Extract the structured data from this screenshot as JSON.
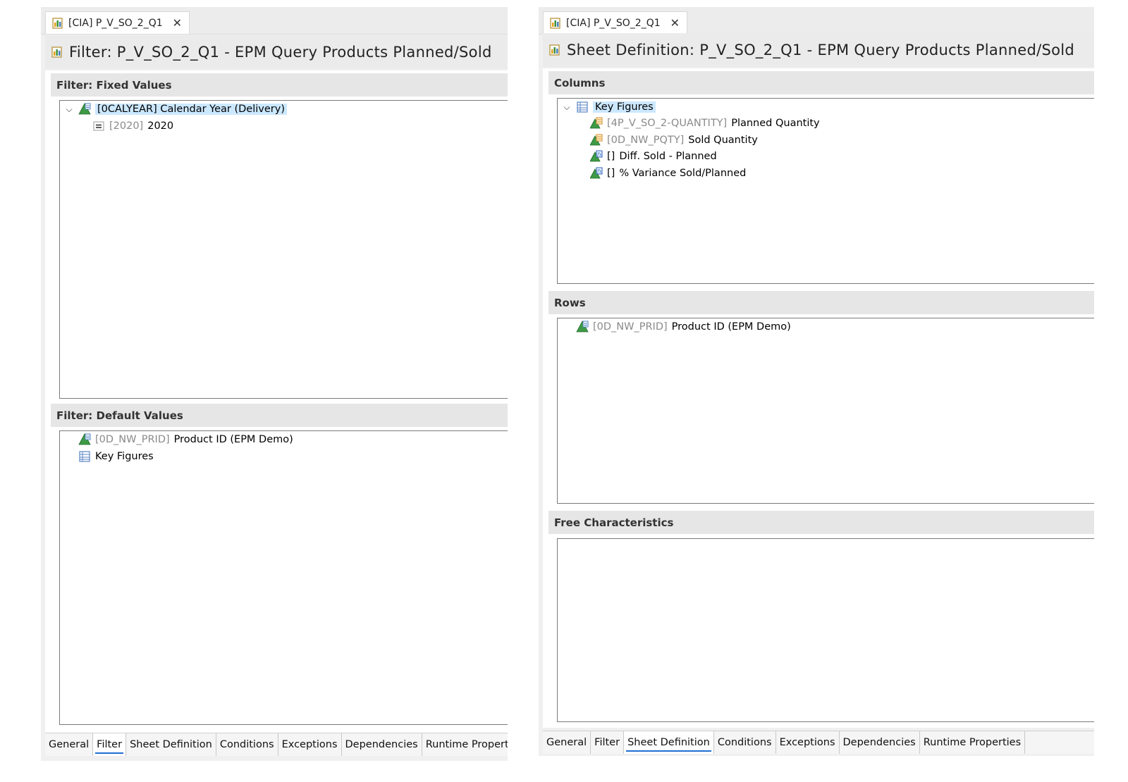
{
  "left": {
    "tab_label": "[CIA] P_V_SO_2_Q1",
    "title": "Filter: P_V_SO_2_Q1 - EPM Query Products Planned/Sold",
    "sections": [
      {
        "header": "Filter: Fixed Values",
        "items": [
          {
            "tech": "[0CALYEAR]",
            "label": "Calendar Year (Delivery)",
            "icon": "characteristic-icon",
            "expanded": true,
            "selected": true
          },
          {
            "tech": "[2020]",
            "label": "2020",
            "icon": "equals-icon"
          }
        ]
      },
      {
        "header": "Filter: Default Values",
        "items": [
          {
            "tech": "[0D_NW_PRID]",
            "label": "Product ID (EPM Demo)",
            "icon": "characteristic-icon"
          },
          {
            "tech": "",
            "label": "Key Figures",
            "icon": "key-figures-structure-icon"
          }
        ]
      }
    ],
    "bottom_tabs": [
      "General",
      "Filter",
      "Sheet Definition",
      "Conditions",
      "Exceptions",
      "Dependencies",
      "Runtime Properties"
    ],
    "active_tab": "Filter"
  },
  "right": {
    "tab_label": "[CIA] P_V_SO_2_Q1",
    "title": "Sheet Definition: P_V_SO_2_Q1 - EPM Query Products Planned/Sold",
    "sections": [
      {
        "header": "Columns",
        "items": [
          {
            "tech": "",
            "label": "Key Figures",
            "icon": "key-figures-structure-icon",
            "expanded": true,
            "selected": true
          },
          {
            "tech": "[4P_V_SO_2-QUANTITY]",
            "label": "Planned Quantity",
            "icon": "key-figure-icon"
          },
          {
            "tech": "[0D_NW_PQTY]",
            "label": "Sold Quantity",
            "icon": "key-figure-icon"
          },
          {
            "tech": "[]",
            "label": "Diff. Sold - Planned",
            "icon": "formula-icon"
          },
          {
            "tech": "[]",
            "label": "% Variance Sold/Planned",
            "icon": "formula-icon"
          }
        ]
      },
      {
        "header": "Rows",
        "items": [
          {
            "tech": "[0D_NW_PRID]",
            "label": "Product ID (EPM Demo)",
            "icon": "characteristic-icon"
          }
        ]
      },
      {
        "header": "Free Characteristics",
        "items": []
      }
    ],
    "bottom_tabs": [
      "General",
      "Filter",
      "Sheet Definition",
      "Conditions",
      "Exceptions",
      "Dependencies",
      "Runtime Properties"
    ],
    "active_tab": "Sheet Definition"
  },
  "colors": {
    "selection": "#cce8ff",
    "active_tab_underline": "#1f6fd1",
    "technical_name": "#8a8a8a"
  }
}
